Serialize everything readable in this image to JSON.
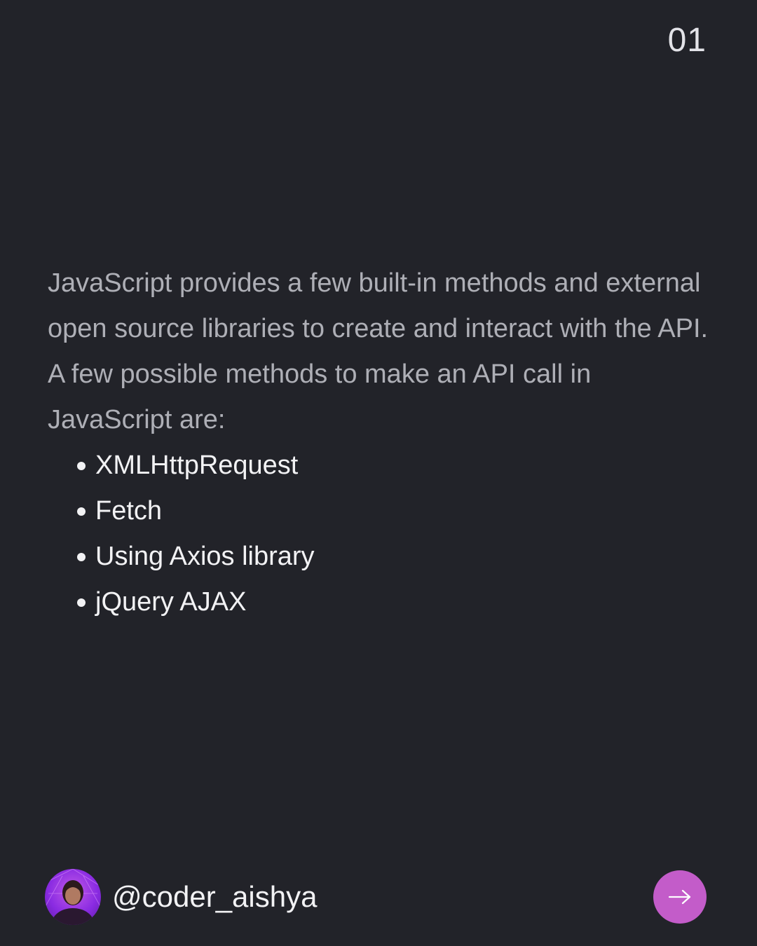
{
  "slide": {
    "page_number": "01"
  },
  "content": {
    "intro_text": "JavaScript provides a few built-in methods and external open source libraries to create and interact with the API. A few possible methods to make an API call in JavaScript are:",
    "methods": [
      "XMLHttpRequest",
      "Fetch",
      "Using Axios library",
      "jQuery AJAX"
    ]
  },
  "footer": {
    "handle": "@coder_aishya",
    "next_icon": "arrow-right-icon"
  },
  "colors": {
    "background": "#222329",
    "intro_text": "#aeafb6",
    "list_text": "#f2f2f4",
    "accent": "#c35cc9"
  }
}
